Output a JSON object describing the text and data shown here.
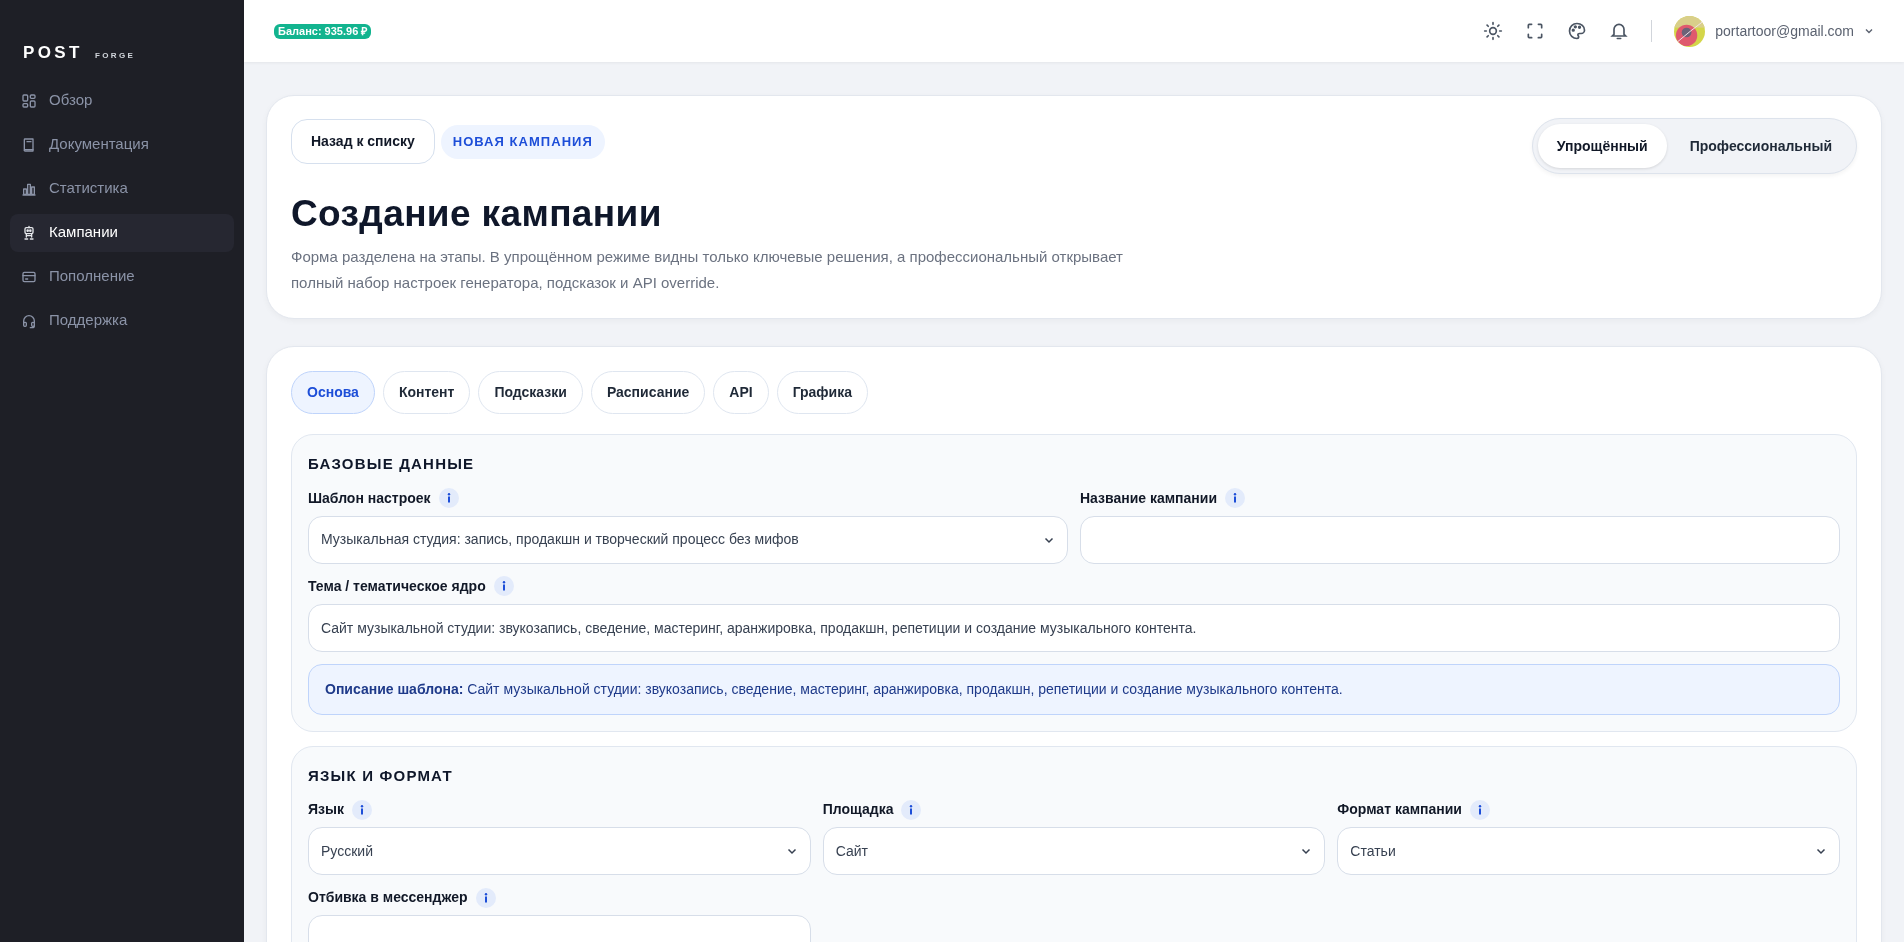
{
  "sidebar": {
    "logo": "POST",
    "logo_sub": "FORGE",
    "items": [
      {
        "label": "Обзор",
        "selected": false
      },
      {
        "label": "Документация",
        "selected": false
      },
      {
        "label": "Статистика",
        "selected": false
      },
      {
        "label": "Кампании",
        "selected": true
      },
      {
        "label": "Пополнение",
        "selected": false
      },
      {
        "label": "Поддержка",
        "selected": false
      }
    ]
  },
  "topbar": {
    "balance": "Баланс: 935.96 ₽",
    "user_email": "portartoor@gmail.com"
  },
  "header": {
    "back_button": "Назад к списку",
    "badge": "НОВАЯ КАМПАНИЯ",
    "modes": [
      {
        "label": "Упрощённый",
        "selected": true
      },
      {
        "label": "Профессиональный",
        "selected": false
      }
    ],
    "title": "Создание кампании",
    "description": "Форма разделена на этапы. В упрощённом режиме видны только ключевые решения, а профессиональный открывает полный набор настроек генератора, подсказок и API override."
  },
  "tabs": [
    {
      "label": "Основа",
      "selected": true
    },
    {
      "label": "Контент",
      "selected": false
    },
    {
      "label": "Подсказки",
      "selected": false
    },
    {
      "label": "Расписание",
      "selected": false
    },
    {
      "label": "API",
      "selected": false
    },
    {
      "label": "Графика",
      "selected": false
    }
  ],
  "sections": [
    {
      "title": "БАЗОВЫЕ ДАННЫЕ",
      "fields": [
        {
          "label": "Шаблон настроек",
          "kind": "select",
          "value": "Музыкальная студия: запись, продакшн и творческий процесс без мифов"
        },
        {
          "label": "Название кампании",
          "kind": "input"
        },
        {
          "label": "Тема / тематическое ядро",
          "kind": "input",
          "value": "Сайт музыкальной студии: звукозапись, сведение, мастеринг, аранжировка, продакшн, репетиции и создание музыкального контента."
        }
      ],
      "note": "**Описание шаблона:** Сайт музыкальной студии: звукозапись, сведение, мастеринг, аранжировка, продакшн, репетиции и создание музыкального контента."
    },
    {
      "title": "ЯЗЫК И ФОРМАТ",
      "fields": [
        {
          "label": "Язык",
          "kind": "select",
          "value": "Русский"
        },
        {
          "label": "Площадка",
          "kind": "select",
          "value": "Сайт"
        },
        {
          "label": "Формат кампании",
          "kind": "select",
          "value": "Статьи"
        },
        {
          "label": "Отбивка в мессенджер",
          "kind": "input"
        }
      ]
    }
  ]
}
